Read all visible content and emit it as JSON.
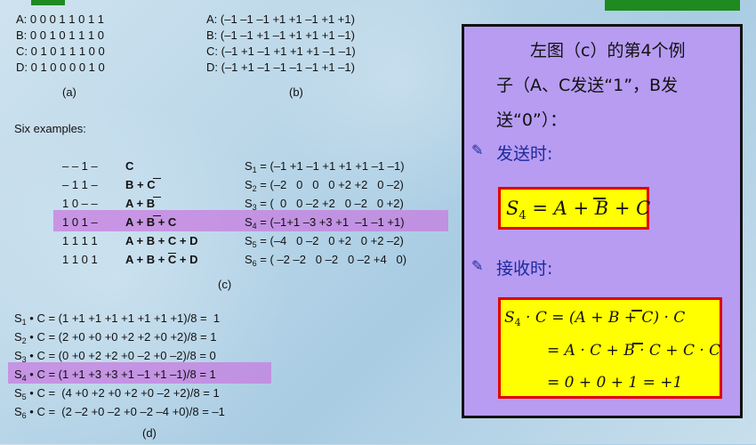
{
  "codes_a": {
    "rows": [
      "A: 0 0 0 1 1 0 1 1",
      "B: 0 0 1 0 1 1 1 0",
      "C: 0 1 0 1 1 1 0 0",
      "D: 0 1 0 0 0 0 1 0"
    ],
    "caption": "(a)"
  },
  "codes_b": {
    "rows": [
      "A: (–1 –1 –1 +1 +1 –1 +1 +1)",
      "B: (–1 –1 +1 –1 +1 +1 +1 –1)",
      "C: (–1 +1 –1 +1 +1 +1 –1 –1)",
      "D: (–1 +1 –1 –1 –1 –1 +1 –1)"
    ],
    "caption": "(b)"
  },
  "examples": {
    "heading": "Six examples:",
    "caption": "(c)",
    "rows": [
      {
        "bits": "– – 1 –",
        "expr": "C",
        "s": "S",
        "n": "1",
        "vec": " = (–1 +1 –1 +1 +1 +1 –1 –1)"
      },
      {
        "bits": "– 1 1 –",
        "expr": "B + C",
        "s": "S",
        "n": "2",
        "vec": " = (–2   0   0   0 +2 +2   0 –2)"
      },
      {
        "bits": "1 0 – –",
        "expr": "A + B",
        "s": "S",
        "n": "3",
        "vec": " = (  0   0 –2 +2   0 –2   0 +2)"
      },
      {
        "bits": "1 0 1 –",
        "expr": "A + B + C",
        "s": "S",
        "n": "4",
        "vec": " = (–1+1 –3 +3 +1  –1 –1 +1)"
      },
      {
        "bits": "1 1 1 1",
        "expr": "A + B + C + D",
        "s": "S",
        "n": "5",
        "vec": " = (–4   0 –2   0 +2   0 +2 –2)"
      },
      {
        "bits": "1 1 0 1",
        "expr": "A + B + C + D",
        "s": "S",
        "n": "6",
        "vec": " = ( –2 –2   0 –2   0 –2 +4   0)"
      }
    ]
  },
  "dot_products": {
    "caption": "(d)",
    "rows": [
      {
        "s": "S",
        "n": "1",
        "text": " • C = (1 +1 +1 +1 +1 +1 +1 +1)/8 =  1"
      },
      {
        "s": "S",
        "n": "2",
        "text": " • C = (2 +0 +0 +0 +2 +2 +0 +2)/8 = 1"
      },
      {
        "s": "S",
        "n": "3",
        "text": " • C = (0 +0 +2 +2 +0 –2 +0 –2)/8 = 0"
      },
      {
        "s": "S",
        "n": "4",
        "text": " • C = (1 +1 +3 +3 +1 –1 +1 –1)/8 = 1"
      },
      {
        "s": "S",
        "n": "5",
        "text": " • C =  (4 +0 +2 +0 +2 +0 –2 +2)/8 = 1"
      },
      {
        "s": "S",
        "n": "6",
        "text": " • C =  (2 –2 +0 –2 +0 –2 –4 +0)/8 = –1"
      }
    ]
  },
  "panel": {
    "intro_line1": "左图（c）的第4个例",
    "intro_line2": "子（A、C发送“1”，B发",
    "intro_line3": "送“0”）：",
    "send_label": "发送时:",
    "send_formula_lhs": "S",
    "send_formula_sub": "4",
    "send_formula_rhs": " = A + B + C",
    "recv_label": "接收时:",
    "recv_line1_lhs": "S",
    "recv_line1_sub": "4",
    "recv_line1_rhs": " · C = (A + B + C) · C",
    "recv_line2": "= A · C + B · C + C · C",
    "recv_line3": "= 0 + 0 + 1 = +1",
    "bullet_icon": "pencil-icon"
  },
  "colors": {
    "highlight": "#c77ce0",
    "panel_bg": "#b79cf2",
    "formula_bg": "#ffff00",
    "formula_border": "#e00000",
    "label_blue": "#1d2a9c",
    "header_green": "#1f8a1f"
  }
}
